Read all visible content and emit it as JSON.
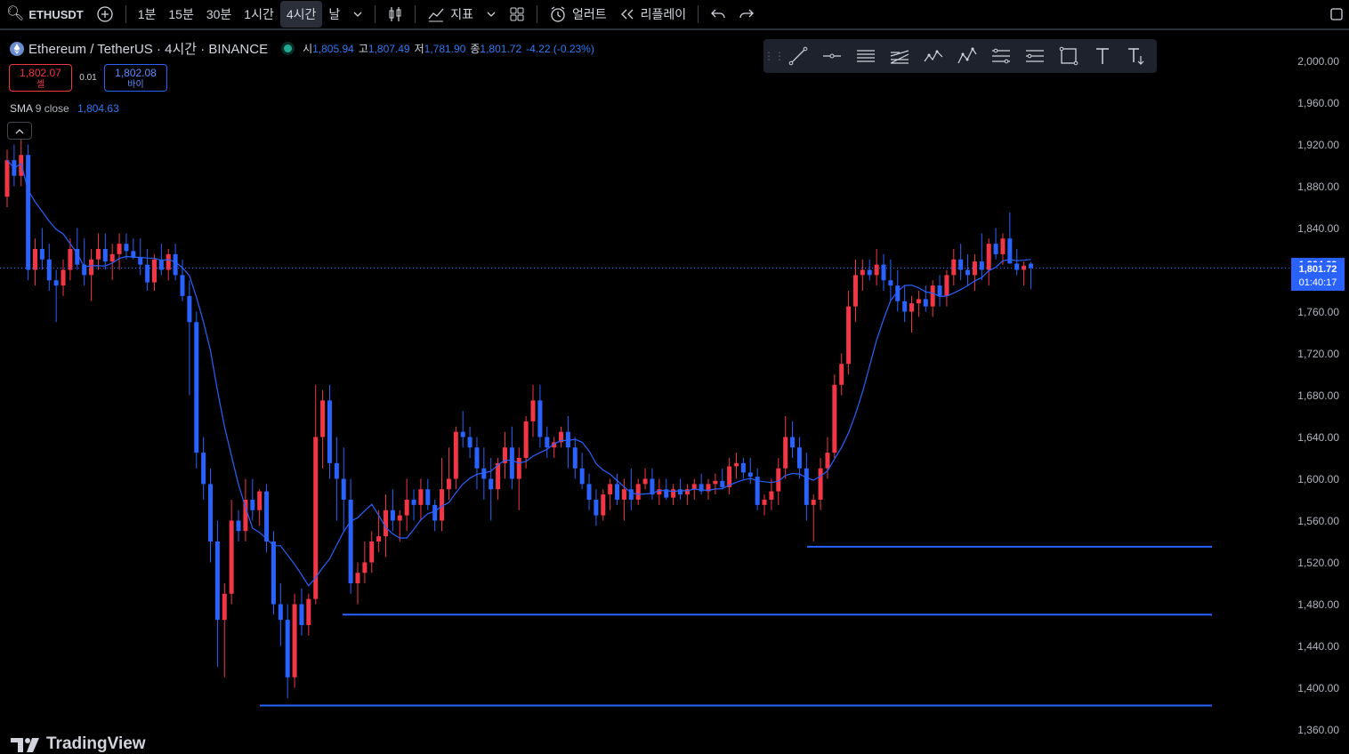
{
  "toolbar": {
    "symbol": "ETHUSDT",
    "intervals": [
      "1분",
      "15분",
      "30분",
      "1시간",
      "4시간",
      "날"
    ],
    "active_interval": "4시간",
    "indicators_label": "지표",
    "alert_label": "얼러트",
    "replay_label": "리플레이"
  },
  "legend": {
    "title": "Ethereum / TetherUS · 4시간 · BINANCE",
    "open_label": "시",
    "open": "1,805.94",
    "high_label": "고",
    "high": "1,807.49",
    "low_label": "저",
    "low": "1,781.90",
    "close_label": "종",
    "close": "1,801.72",
    "change": "-4.22 (-0.23%)"
  },
  "trade": {
    "sell_price": "1,802.07",
    "sell_label": "셀",
    "spread": "0.01",
    "buy_price": "1,802.08",
    "buy_label": "바이"
  },
  "indicator": {
    "name": "SMA",
    "params": "9 close",
    "value": "1,804.63"
  },
  "price_axis": {
    "ticks": [
      "2,000.00",
      "1,960.00",
      "1,920.00",
      "1,880.00",
      "1,840.00",
      "1,800.00",
      "1,760.00",
      "1,720.00",
      "1,680.00",
      "1,640.00",
      "1,600.00",
      "1,560.00",
      "1,520.00",
      "1,480.00",
      "1,440.00",
      "1,400.00",
      "1,360.00"
    ],
    "sma_tag": "1,804.63",
    "price_tag": "1,801.72",
    "countdown": "01:40:17"
  },
  "branding": {
    "logo_text": "TradingView"
  },
  "colors": {
    "up": "#f23645",
    "down": "#2962ff",
    "sma": "#2962ff",
    "accent": "#2962ff",
    "background": "#000000"
  },
  "chart_data": {
    "type": "candlestick",
    "symbol": "ETHUSDT",
    "interval": "4시간",
    "ylim": [
      1350,
      2030
    ],
    "color_convention": "red = rising, blue = falling",
    "candles": [
      [
        1870,
        1915,
        1860,
        1905
      ],
      [
        1905,
        1920,
        1880,
        1890
      ],
      [
        1890,
        1925,
        1880,
        1910
      ],
      [
        1910,
        1920,
        1790,
        1800
      ],
      [
        1800,
        1830,
        1785,
        1820
      ],
      [
        1820,
        1840,
        1800,
        1810
      ],
      [
        1810,
        1825,
        1780,
        1790
      ],
      [
        1790,
        1800,
        1750,
        1785
      ],
      [
        1785,
        1810,
        1775,
        1800
      ],
      [
        1800,
        1830,
        1790,
        1820
      ],
      [
        1820,
        1840,
        1800,
        1805
      ],
      [
        1805,
        1830,
        1785,
        1795
      ],
      [
        1795,
        1820,
        1770,
        1810
      ],
      [
        1810,
        1835,
        1800,
        1820
      ],
      [
        1820,
        1835,
        1800,
        1808
      ],
      [
        1808,
        1825,
        1790,
        1815
      ],
      [
        1815,
        1835,
        1800,
        1825
      ],
      [
        1825,
        1835,
        1810,
        1818
      ],
      [
        1818,
        1830,
        1810,
        1812
      ],
      [
        1812,
        1830,
        1795,
        1805
      ],
      [
        1805,
        1820,
        1780,
        1788
      ],
      [
        1788,
        1815,
        1780,
        1810
      ],
      [
        1810,
        1825,
        1795,
        1800
      ],
      [
        1800,
        1820,
        1790,
        1815
      ],
      [
        1815,
        1825,
        1790,
        1795
      ],
      [
        1795,
        1810,
        1770,
        1775
      ],
      [
        1775,
        1790,
        1680,
        1750
      ],
      [
        1750,
        1760,
        1610,
        1625
      ],
      [
        1625,
        1640,
        1580,
        1595
      ],
      [
        1595,
        1610,
        1520,
        1540
      ],
      [
        1540,
        1560,
        1420,
        1465
      ],
      [
        1465,
        1500,
        1410,
        1490
      ],
      [
        1490,
        1580,
        1480,
        1560
      ],
      [
        1560,
        1570,
        1540,
        1550
      ],
      [
        1550,
        1600,
        1540,
        1580
      ],
      [
        1580,
        1600,
        1560,
        1570
      ],
      [
        1570,
        1590,
        1555,
        1588
      ],
      [
        1588,
        1595,
        1530,
        1540
      ],
      [
        1540,
        1550,
        1470,
        1480
      ],
      [
        1480,
        1500,
        1440,
        1465
      ],
      [
        1465,
        1480,
        1390,
        1410
      ],
      [
        1410,
        1490,
        1400,
        1480
      ],
      [
        1480,
        1495,
        1450,
        1460
      ],
      [
        1460,
        1490,
        1450,
        1485
      ],
      [
        1485,
        1690,
        1480,
        1640
      ],
      [
        1640,
        1685,
        1610,
        1675
      ],
      [
        1675,
        1690,
        1600,
        1615
      ],
      [
        1615,
        1640,
        1560,
        1600
      ],
      [
        1600,
        1630,
        1550,
        1580
      ],
      [
        1580,
        1600,
        1490,
        1500
      ],
      [
        1500,
        1520,
        1480,
        1510
      ],
      [
        1510,
        1540,
        1500,
        1520
      ],
      [
        1520,
        1550,
        1510,
        1540
      ],
      [
        1540,
        1570,
        1530,
        1545
      ],
      [
        1545,
        1585,
        1525,
        1570
      ],
      [
        1570,
        1590,
        1550,
        1560
      ],
      [
        1560,
        1570,
        1540,
        1565
      ],
      [
        1565,
        1600,
        1550,
        1580
      ],
      [
        1580,
        1590,
        1560,
        1575
      ],
      [
        1575,
        1600,
        1560,
        1590
      ],
      [
        1590,
        1600,
        1570,
        1575
      ],
      [
        1575,
        1580,
        1550,
        1560
      ],
      [
        1560,
        1620,
        1550,
        1590
      ],
      [
        1590,
        1630,
        1580,
        1600
      ],
      [
        1600,
        1650,
        1590,
        1645
      ],
      [
        1645,
        1665,
        1630,
        1640
      ],
      [
        1640,
        1650,
        1620,
        1630
      ],
      [
        1630,
        1640,
        1590,
        1610
      ],
      [
        1610,
        1630,
        1580,
        1600
      ],
      [
        1600,
        1620,
        1560,
        1590
      ],
      [
        1590,
        1620,
        1580,
        1615
      ],
      [
        1615,
        1645,
        1600,
        1630
      ],
      [
        1630,
        1650,
        1590,
        1600
      ],
      [
        1600,
        1630,
        1570,
        1620
      ],
      [
        1620,
        1660,
        1610,
        1655
      ],
      [
        1655,
        1690,
        1640,
        1675
      ],
      [
        1675,
        1690,
        1630,
        1640
      ],
      [
        1640,
        1650,
        1620,
        1630
      ],
      [
        1630,
        1640,
        1620,
        1635
      ],
      [
        1635,
        1650,
        1630,
        1645
      ],
      [
        1645,
        1660,
        1610,
        1630
      ],
      [
        1630,
        1640,
        1600,
        1610
      ],
      [
        1610,
        1625,
        1590,
        1595
      ],
      [
        1595,
        1605,
        1570,
        1580
      ],
      [
        1580,
        1590,
        1555,
        1565
      ],
      [
        1565,
        1590,
        1560,
        1585
      ],
      [
        1585,
        1600,
        1570,
        1595
      ],
      [
        1595,
        1605,
        1575,
        1580
      ],
      [
        1580,
        1600,
        1560,
        1590
      ],
      [
        1590,
        1610,
        1570,
        1580
      ],
      [
        1580,
        1600,
        1575,
        1595
      ],
      [
        1595,
        1610,
        1590,
        1600
      ],
      [
        1600,
        1610,
        1580,
        1585
      ],
      [
        1585,
        1600,
        1575,
        1590
      ],
      [
        1590,
        1600,
        1580,
        1582
      ],
      [
        1582,
        1595,
        1575,
        1590
      ],
      [
        1590,
        1600,
        1580,
        1585
      ],
      [
        1585,
        1595,
        1575,
        1590
      ],
      [
        1590,
        1600,
        1580,
        1595
      ],
      [
        1595,
        1605,
        1585,
        1588
      ],
      [
        1588,
        1600,
        1580,
        1595
      ],
      [
        1595,
        1605,
        1585,
        1598
      ],
      [
        1598,
        1610,
        1590,
        1592
      ],
      [
        1592,
        1620,
        1585,
        1612
      ],
      [
        1612,
        1625,
        1600,
        1615
      ],
      [
        1615,
        1620,
        1600,
        1606
      ],
      [
        1606,
        1620,
        1595,
        1602
      ],
      [
        1602,
        1610,
        1570,
        1575
      ],
      [
        1575,
        1585,
        1565,
        1580
      ],
      [
        1580,
        1600,
        1570,
        1588
      ],
      [
        1588,
        1620,
        1575,
        1610
      ],
      [
        1610,
        1660,
        1600,
        1640
      ],
      [
        1640,
        1655,
        1620,
        1630
      ],
      [
        1630,
        1640,
        1600,
        1610
      ],
      [
        1610,
        1625,
        1560,
        1575
      ],
      [
        1575,
        1585,
        1540,
        1580
      ],
      [
        1580,
        1620,
        1570,
        1610
      ],
      [
        1610,
        1640,
        1600,
        1625
      ],
      [
        1625,
        1700,
        1620,
        1690
      ],
      [
        1690,
        1720,
        1680,
        1710
      ],
      [
        1710,
        1780,
        1700,
        1765
      ],
      [
        1765,
        1810,
        1750,
        1795
      ],
      [
        1795,
        1810,
        1780,
        1800
      ],
      [
        1800,
        1810,
        1790,
        1795
      ],
      [
        1795,
        1820,
        1785,
        1805
      ],
      [
        1805,
        1815,
        1780,
        1790
      ],
      [
        1790,
        1810,
        1770,
        1785
      ],
      [
        1785,
        1800,
        1760,
        1770
      ],
      [
        1770,
        1785,
        1750,
        1760
      ],
      [
        1760,
        1775,
        1740,
        1768
      ],
      [
        1768,
        1780,
        1755,
        1772
      ],
      [
        1772,
        1785,
        1760,
        1765
      ],
      [
        1765,
        1790,
        1755,
        1785
      ],
      [
        1785,
        1795,
        1765,
        1775
      ],
      [
        1775,
        1800,
        1765,
        1795
      ],
      [
        1795,
        1820,
        1785,
        1810
      ],
      [
        1810,
        1825,
        1790,
        1800
      ],
      [
        1800,
        1815,
        1785,
        1795
      ],
      [
        1795,
        1815,
        1780,
        1808
      ],
      [
        1808,
        1835,
        1790,
        1800
      ],
      [
        1800,
        1830,
        1785,
        1825
      ],
      [
        1825,
        1840,
        1810,
        1815
      ],
      [
        1815,
        1835,
        1805,
        1830
      ],
      [
        1830,
        1855,
        1820,
        1806
      ],
      [
        1806,
        1820,
        1795,
        1800
      ],
      [
        1800,
        1808,
        1785,
        1804
      ],
      [
        1805.94,
        1807.49,
        1781.9,
        1801.72
      ]
    ],
    "sma": {
      "name": "SMA",
      "params": "9 close",
      "last": 1804.63
    },
    "levels": [
      1535,
      1470,
      1383
    ]
  }
}
